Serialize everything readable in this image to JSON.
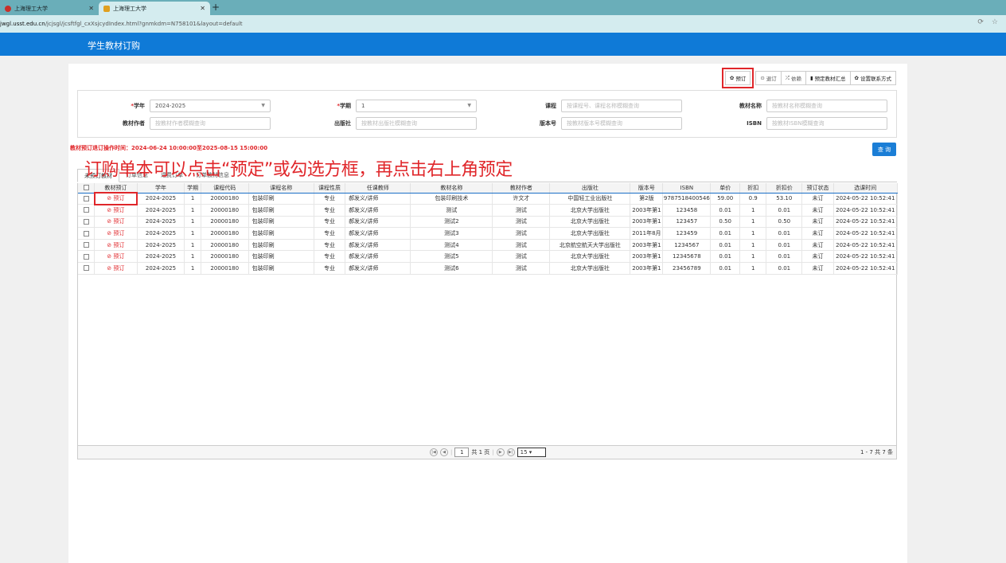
{
  "browser": {
    "tabs": [
      {
        "label": "上海理工大学"
      },
      {
        "label": "上海理工大学"
      }
    ],
    "url_host": "jwgl.usst.edu.cn",
    "url_path": "/jcjsgl/jcsftfgl_cxXsjcydIndex.html?gnmkdm=N758101&layout=default"
  },
  "app": {
    "title": "学生教材订购"
  },
  "toolbar": {
    "order": "预订",
    "unorder": "退订",
    "dependency": "依赖",
    "summary": "预定教材汇总",
    "contact": "设置联系方式"
  },
  "filters": {
    "year_label": "学年",
    "year_value": "2024-2025",
    "term_label": "学期",
    "term_value": "1",
    "course_label": "课程",
    "course_placeholder": "按课程号、课程名称模糊查询",
    "bookname_label": "教材名称",
    "bookname_placeholder": "按教材名称模糊查询",
    "author_label": "教材作者",
    "author_placeholder": "按教材作者模糊查询",
    "publisher_label": "出版社",
    "publisher_placeholder": "按教材出版社模糊查询",
    "edition_label": "版本号",
    "edition_placeholder": "按教材版本号模糊查询",
    "isbn_label": "ISBN",
    "isbn_placeholder": "按教材ISBN模糊查询"
  },
  "notice": "教材预订退订操作时间：2024-06-24 10:00:00至2025-08-15 15:00:00",
  "query_button": "查 询",
  "annotation": "订购单本可以点击“预定”或勾选方框，再点击右上角预定",
  "tabs": [
    "未预订教材",
    "订单信息",
    "退费订单",
    "订单教材信息"
  ],
  "table": {
    "headers": [
      "教材预订",
      "学年",
      "学期",
      "课程代码",
      "课程名称",
      "课程性质",
      "任课教师",
      "教材名称",
      "教材作者",
      "出版社",
      "版本号",
      "ISBN",
      "单价",
      "折扣",
      "折扣价",
      "预订状态",
      "选课时间"
    ],
    "rows": [
      [
        "预订",
        "2024-2025",
        "1",
        "20000180",
        "包装印刷",
        "专业",
        "郝发义/讲师",
        "包装印刷技术",
        "许文才",
        "中国轻工业出版社",
        "第2版",
        "9787518400546",
        "59.00",
        "0.9",
        "53.10",
        "未订",
        "2024-05-22 10:52:41"
      ],
      [
        "预订",
        "2024-2025",
        "1",
        "20000180",
        "包装印刷",
        "专业",
        "郝发义/讲师",
        "测试",
        "测试",
        "北京大学出版社",
        "2003年第1",
        "123458",
        "0.01",
        "1",
        "0.01",
        "未订",
        "2024-05-22 10:52:41"
      ],
      [
        "预订",
        "2024-2025",
        "1",
        "20000180",
        "包装印刷",
        "专业",
        "郝发义/讲师",
        "测试2",
        "测试",
        "北京大学出版社",
        "2003年第1",
        "123457",
        "0.50",
        "1",
        "0.50",
        "未订",
        "2024-05-22 10:52:41"
      ],
      [
        "预订",
        "2024-2025",
        "1",
        "20000180",
        "包装印刷",
        "专业",
        "郝发义/讲师",
        "测试3",
        "测试",
        "北京大学出版社",
        "2011年8月",
        "123459",
        "0.01",
        "1",
        "0.01",
        "未订",
        "2024-05-22 10:52:41"
      ],
      [
        "预订",
        "2024-2025",
        "1",
        "20000180",
        "包装印刷",
        "专业",
        "郝发义/讲师",
        "测试4",
        "测试",
        "北京航空航天大学出版社",
        "2003年第1",
        "1234567",
        "0.01",
        "1",
        "0.01",
        "未订",
        "2024-05-22 10:52:41"
      ],
      [
        "预订",
        "2024-2025",
        "1",
        "20000180",
        "包装印刷",
        "专业",
        "郝发义/讲师",
        "测试5",
        "测试",
        "北京大学出版社",
        "2003年第1",
        "12345678",
        "0.01",
        "1",
        "0.01",
        "未订",
        "2024-05-22 10:52:41"
      ],
      [
        "预订",
        "2024-2025",
        "1",
        "20000180",
        "包装印刷",
        "专业",
        "郝发义/讲师",
        "测试6",
        "测试",
        "北京大学出版社",
        "2003年第1",
        "23456789",
        "0.01",
        "1",
        "0.01",
        "未订",
        "2024-05-22 10:52:41"
      ]
    ]
  },
  "pager": {
    "page": "1",
    "total_pages": "共 1 页",
    "page_size": "15",
    "summary": "1 - 7  共 7 条"
  },
  "colors": {
    "brand": "#0f7ad7",
    "alert": "#e0262a",
    "tabbar": "#6aaeb9"
  }
}
